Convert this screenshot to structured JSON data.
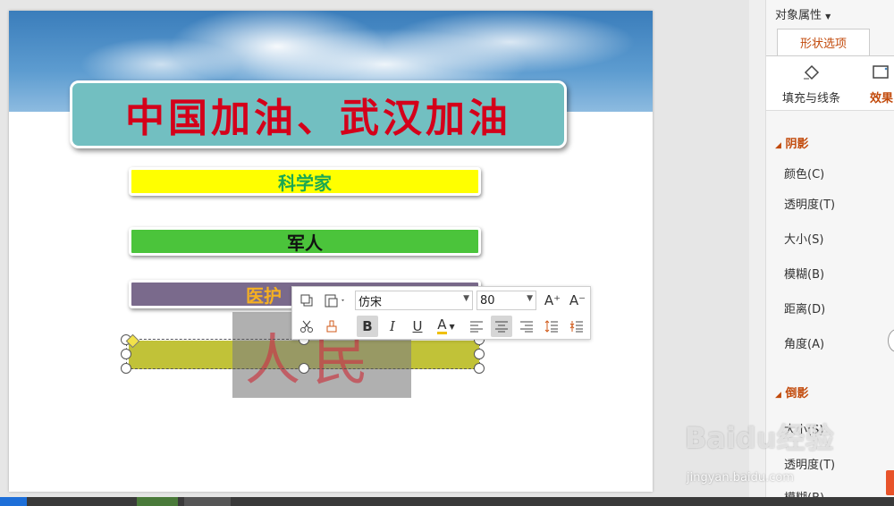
{
  "slide": {
    "title": "中国加油、武汉加油",
    "bars": [
      "科学家",
      "军人",
      "医护"
    ],
    "selected_text": "人民"
  },
  "toolbar": {
    "font_name": "仿宋",
    "font_size": "80",
    "bold": "B",
    "italic": "I",
    "underline": "U",
    "font_color": "A",
    "grow_font": "A⁺",
    "shrink_font": "A⁻"
  },
  "panel": {
    "header": "对象属性",
    "tab_shape": "形状选项",
    "subtab_fill": "填充与线条",
    "subtab_effect": "效果",
    "shadow_section": "阴影",
    "shadow_rows": [
      "颜色(C)",
      "透明度(T)",
      "大小(S)",
      "模糊(B)",
      "距离(D)",
      "角度(A)"
    ],
    "reflection_section": "倒影",
    "reflection_rows": [
      "大小(S)",
      "透明度(T)",
      "模糊(B)"
    ]
  },
  "watermark": {
    "brand": "Baidu经验",
    "url": "jingyan.baidu.com"
  },
  "colors": {
    "accent": "#c24a0b",
    "title_box": "#72bfc1",
    "title_text": "#d4001a"
  }
}
